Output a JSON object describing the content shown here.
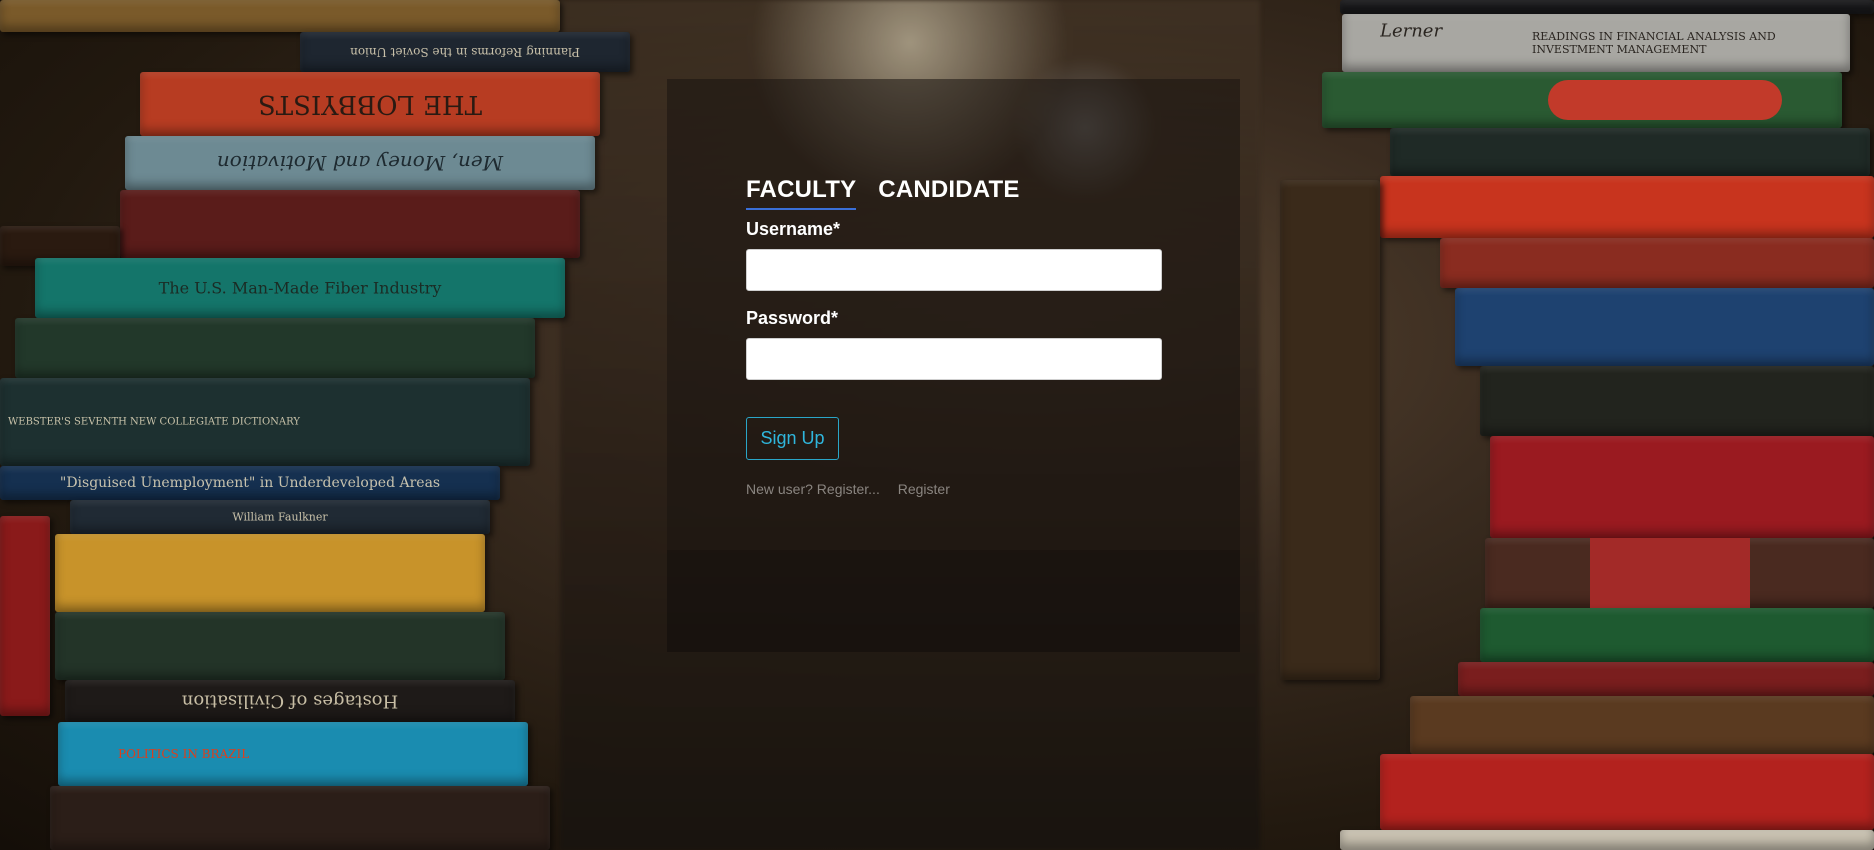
{
  "login": {
    "tabs": [
      {
        "label": "FACULTY",
        "active": true
      },
      {
        "label": "CANDIDATE",
        "active": false
      }
    ],
    "username_label": "Username*",
    "password_label": "Password*",
    "username_value": "",
    "password_value": "",
    "signup_label": "Sign Up",
    "new_user_link": "New user? Register...",
    "register_link": "Register"
  },
  "background": {
    "book_titles_left": [
      "Planning Reforms in the Soviet Union",
      "THE LOBBYISTS",
      "Men, Money and Motivation",
      "The U.S. Man-Made Fiber Industry",
      "WEBSTER'S SEVENTH NEW COLLEGIATE DICTIONARY",
      "\"Disguised Unemployment\" in Underdeveloped Areas",
      "William Faulkner",
      "Hostages of Civilisation",
      "POLITICS IN BRAZIL"
    ],
    "book_titles_right": [
      "Lerner",
      "READINGS IN FINANCIAL ANALYSIS AND INVESTMENT MANAGEMENT"
    ]
  },
  "colors": {
    "accent": "#2fb6dc",
    "tab_underline": "#3a6fd8",
    "panel_bg": "rgba(25,20,16,0.55)"
  }
}
